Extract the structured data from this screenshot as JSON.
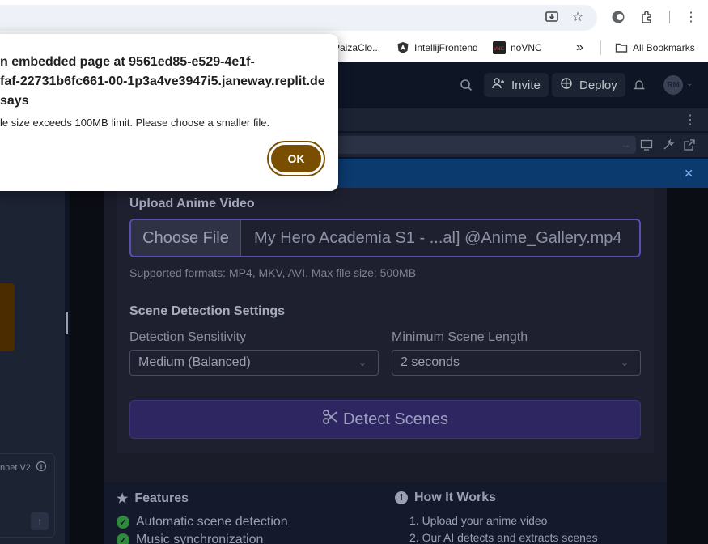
{
  "browser": {
    "bookmarks": [
      {
        "label": "PaizaClo..."
      },
      {
        "label": "IntellijFrontend"
      },
      {
        "label": "noVNC"
      },
      {
        "label": "All Bookmarks"
      }
    ],
    "more_label": "»"
  },
  "replit": {
    "invite_label": "Invite",
    "deploy_label": "Deploy",
    "avatar_initials": "RM"
  },
  "form": {
    "upload_label": "Upload Anime Video",
    "choose_file_label": "Choose File",
    "file_name": "My Hero Academia S1 - ...al] @Anime_Gallery.mp4",
    "formats_hint": "Supported formats: MP4, MKV, AVI. Max file size: 500MB",
    "settings_label": "Scene Detection Settings",
    "sensitivity_label": "Detection Sensitivity",
    "sensitivity_value": "Medium (Balanced)",
    "min_length_label": "Minimum Scene Length",
    "min_length_value": "2 seconds",
    "detect_label": "Detect Scenes"
  },
  "features": {
    "title": "Features",
    "items": [
      "Automatic scene detection",
      "Music synchronization"
    ]
  },
  "how_it_works": {
    "title": "How It Works",
    "steps": [
      "1. Upload your anime video",
      "2. Our AI detects and extracts scenes"
    ]
  },
  "ai_panel": {
    "model_label": "nnet V2"
  },
  "dialog": {
    "title_line1": "n embedded page at 9561ed85-e529-4e1f-",
    "title_line2": "faf-22731b6fc661-00-1p3a4ve3947i5.janeway.replit.de",
    "title_line3": "says",
    "message": "le size exceeds 100MB limit. Please choose a smaller file.",
    "ok_label": "OK"
  }
}
